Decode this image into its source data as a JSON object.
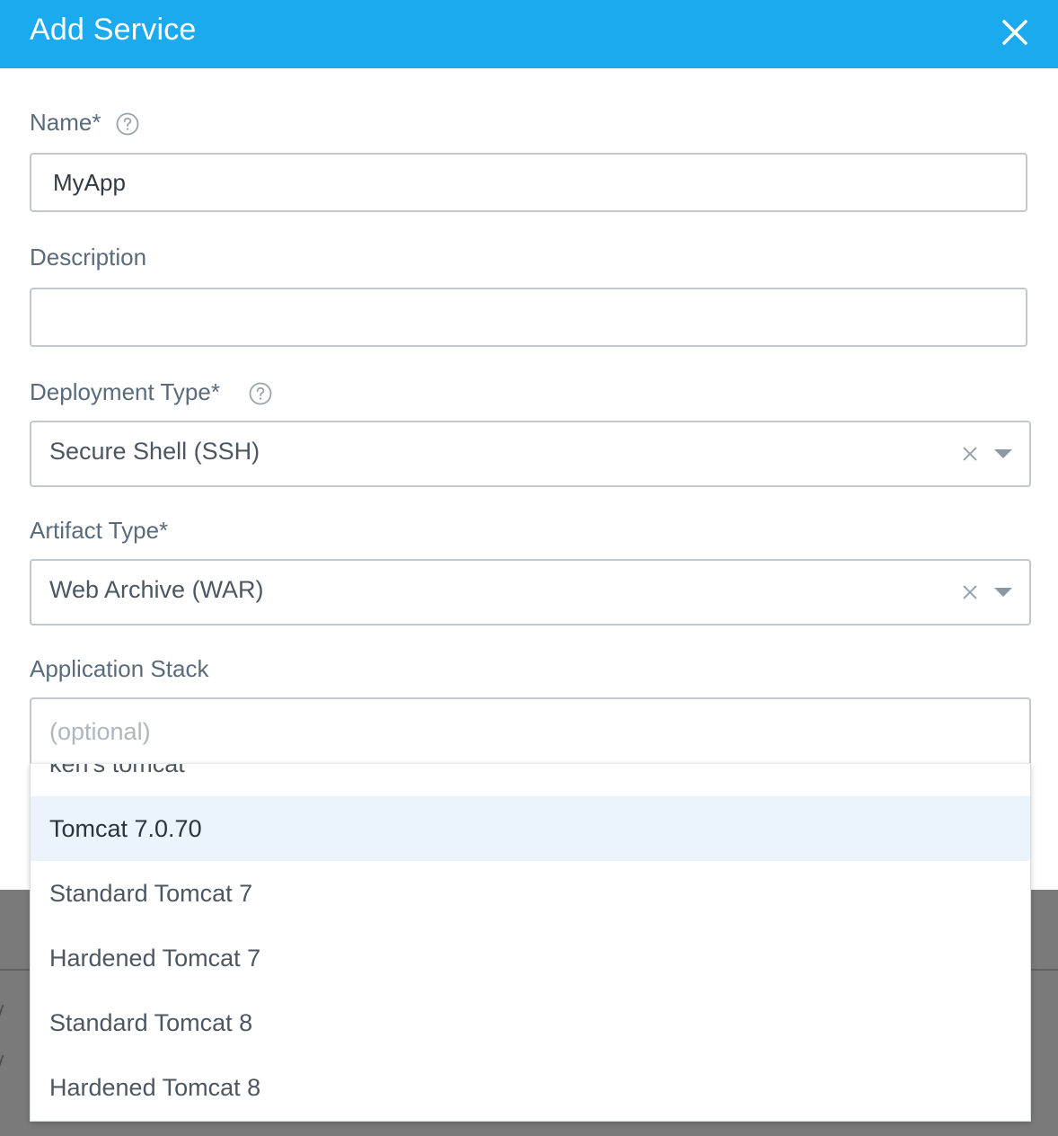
{
  "modal": {
    "title": "Add Service"
  },
  "fields": {
    "name": {
      "label": "Name*",
      "value": "MyApp"
    },
    "description": {
      "label": "Description",
      "value": ""
    },
    "deployment_type": {
      "label": "Deployment Type*",
      "value": "Secure Shell (SSH)"
    },
    "artifact_type": {
      "label": "Artifact Type*",
      "value": "Web Archive (WAR)"
    },
    "application_stack": {
      "label": "Application Stack",
      "placeholder": "(optional)"
    }
  },
  "dropdown": {
    "highlighted_option": "Tomcat 7.0.70",
    "options": [
      "ken's tomcat",
      "Tomcat 7.0.70",
      "Standard Tomcat 7",
      "Hardened Tomcat 7",
      "Standard Tomcat 8",
      "Hardened Tomcat 8"
    ]
  },
  "colors": {
    "header": "#1caaef",
    "label": "#5a6b7b",
    "highlight": "#ebf4fd"
  },
  "icons": {
    "close": "close-icon",
    "help": "help-circle-icon",
    "clear": "clear-x-icon",
    "arrow": "caret-down-icon"
  }
}
